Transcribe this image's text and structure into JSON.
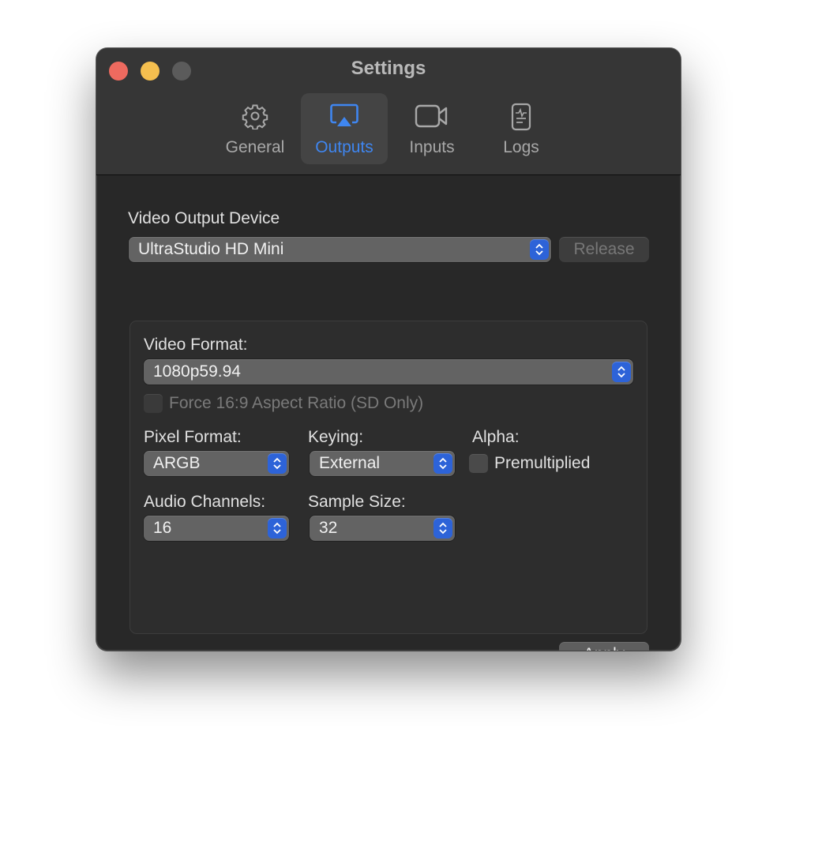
{
  "window": {
    "title": "Settings",
    "controls": {
      "close": "close-button",
      "minimize": "minimize-button",
      "zoom": "zoom-button"
    }
  },
  "tabs": [
    {
      "label": "General",
      "icon": "gear-icon",
      "active": false
    },
    {
      "label": "Outputs",
      "icon": "airplay-icon",
      "active": true
    },
    {
      "label": "Inputs",
      "icon": "video-camera-icon",
      "active": false
    },
    {
      "label": "Logs",
      "icon": "log-document-icon",
      "active": false
    }
  ],
  "colors": {
    "accent": "#3f86f0",
    "stepper": "#2d63d8",
    "close": "#ee6a5f",
    "minimize": "#f5bf4f",
    "zoom_disabled": "#5b5b5b"
  },
  "output": {
    "device_label": "Video Output Device",
    "device_value": "UltraStudio HD Mini",
    "release_label": "Release",
    "release_enabled": false,
    "video_format_label": "Video Format:",
    "video_format_value": "1080p59.94",
    "force_aspect_label": "Force 16:9 Aspect Ratio (SD Only)",
    "force_aspect_checked": false,
    "force_aspect_enabled": false,
    "pixel_format_label": "Pixel Format:",
    "pixel_format_value": "ARGB",
    "keying_label": "Keying:",
    "keying_value": "External",
    "alpha_label": "Alpha:",
    "premultiplied_label": "Premultiplied",
    "premultiplied_checked": false,
    "audio_channels_label": "Audio Channels:",
    "audio_channels_value": "16",
    "sample_size_label": "Sample Size:",
    "sample_size_value": "32",
    "apply_label": "Apply"
  }
}
